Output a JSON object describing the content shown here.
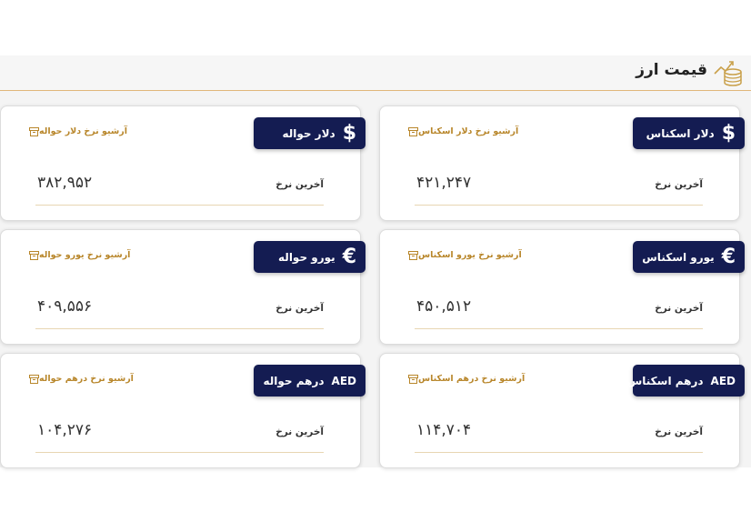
{
  "header": {
    "title": "قیمت ارز",
    "icon": "coins-chart-icon"
  },
  "cards": {
    "usd_cash": {
      "label": "دلار اسکناس",
      "symbol": "$",
      "archive": "آرشیو نرخ دلار اسکناس",
      "last_label": "آخرین نرخ",
      "value": "۴۲۱,۲۴۷"
    },
    "usd_transfer": {
      "label": "دلار حواله",
      "symbol": "$",
      "archive": "آرشیو نرخ دلار حواله",
      "last_label": "آخرین نرخ",
      "value": "۳۸۲,۹۵۲"
    },
    "eur_cash": {
      "label": "یورو اسکناس",
      "symbol": "€",
      "archive": "آرشیو نرخ یورو اسکناس",
      "last_label": "آخرین نرخ",
      "value": "۴۵۰,۵۱۲"
    },
    "eur_transfer": {
      "label": "یورو حواله",
      "symbol": "€",
      "archive": "آرشیو نرخ یورو حواله",
      "last_label": "آخرین نرخ",
      "value": "۴۰۹,۵۵۶"
    },
    "aed_cash": {
      "label": "درهم اسکناس",
      "symbol": "AED",
      "archive": "آرشیو نرخ درهم اسکناس",
      "last_label": "آخرین نرخ",
      "value": "۱۱۴,۷۰۴"
    },
    "aed_transfer": {
      "label": "درهم حواله",
      "symbol": "AED",
      "archive": "آرشیو نرخ درهم حواله",
      "last_label": "آخرین نرخ",
      "value": "۱۰۴,۲۷۶"
    }
  },
  "colors": {
    "badge_bg": "#141c52",
    "accent_gold": "#b8862a"
  }
}
